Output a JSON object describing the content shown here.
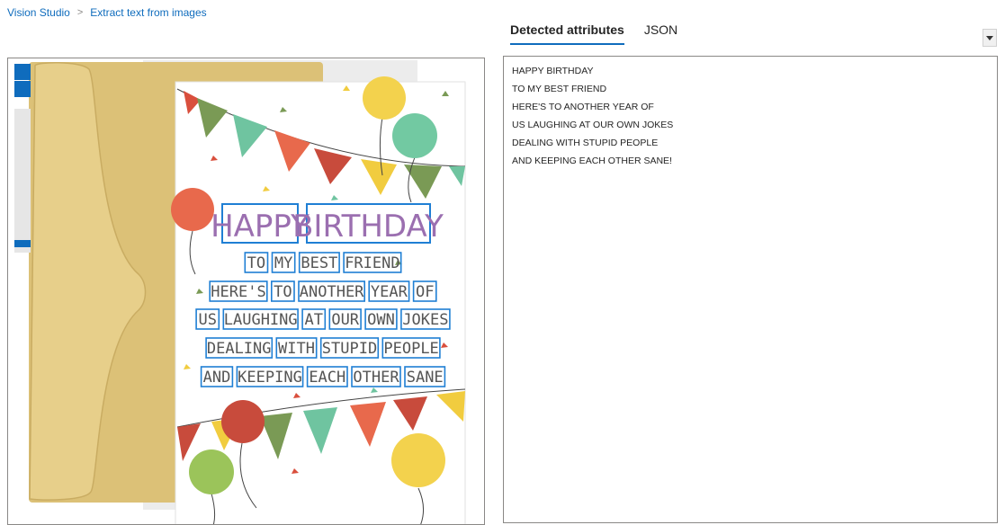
{
  "breadcrumb": {
    "root": "Vision Studio",
    "separator": ">",
    "current": "Extract text from images"
  },
  "tabs": [
    {
      "label": "Detected attributes",
      "active": true
    },
    {
      "label": "JSON",
      "active": false
    }
  ],
  "card": {
    "lines": [
      [
        "HAPPY",
        "BIRTHDAY"
      ],
      [
        "TO",
        "MY",
        "BEST",
        "FRIEND"
      ],
      [
        "HERE'S",
        "TO",
        "ANOTHER",
        "YEAR",
        "OF"
      ],
      [
        "US",
        "LAUGHING",
        "AT",
        "OUR",
        "OWN",
        "JOKES"
      ],
      [
        "DEALING",
        "WITH",
        "STUPID",
        "PEOPLE"
      ],
      [
        "AND",
        "KEEPING",
        "EACH",
        "OTHER",
        "SANE"
      ]
    ]
  },
  "results": {
    "lines": [
      "HAPPY BIRTHDAY",
      "TO MY BEST FRIEND",
      "HERE'S TO ANOTHER YEAR OF",
      "US LAUGHING AT OUR OWN JOKES",
      "DEALING WITH STUPID PEOPLE",
      "AND KEEPING EACH OTHER SANE!"
    ]
  },
  "colors": {
    "accent": "#0f6cbd",
    "title_purple": "#9b6fb0",
    "box_blue": "#1f7fd4",
    "text_gray": "#555555"
  },
  "icons": {
    "collapse": "chevron-down-icon"
  }
}
